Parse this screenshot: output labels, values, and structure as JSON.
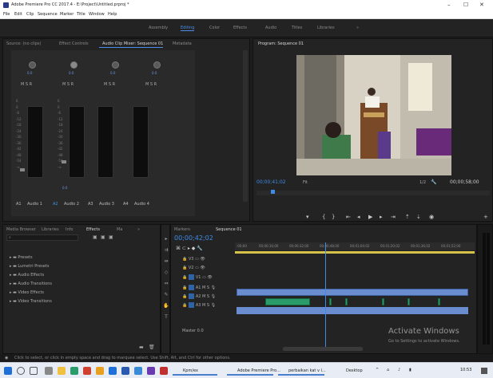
{
  "titlebar": {
    "title": "Adobe Premiere Pro CC 2017.4 - E:\\Project\\Untitled.prproj *",
    "minimize": "–",
    "maximize": "☐",
    "close": "✕"
  },
  "menubar": {
    "items": [
      "File",
      "Edit",
      "Clip",
      "Sequence",
      "Marker",
      "Title",
      "Window",
      "Help"
    ]
  },
  "workspaces": {
    "items": [
      "Assembly",
      "Editing",
      "Color",
      "Effects",
      "Audio",
      "Titles",
      "Libraries",
      "»"
    ],
    "active_index": 1
  },
  "mixer": {
    "tabs": [
      "Source: (no clips)",
      "Effect Controls",
      "Audio Clip Mixer: Sequence 01",
      "Metadata"
    ],
    "active_tab": 2,
    "track_labels": [
      "Audio 1",
      "Audio 2",
      "Audio 3",
      "Audio 4"
    ],
    "track_codes": [
      "A1",
      "A2",
      "A3",
      "A4"
    ],
    "value_label": "0.0",
    "mixer_tab_close": "≡"
  },
  "program": {
    "tab": "Program: Sequence 01",
    "timecode_left": "00;00;41;02",
    "timecode_right": "00;00;58;00",
    "zoom": "Fit",
    "quality": "1/2"
  },
  "project": {
    "tabs": [
      "Media Browser",
      "Libraries",
      "Info",
      "Effects",
      "Ma",
      "»"
    ],
    "active_tab": 3,
    "search_placeholder": "",
    "folders": [
      "Presets",
      "Lumetri Presets",
      "Audio Effects",
      "Audio Transitions",
      "Video Effects",
      "Video Transitions"
    ]
  },
  "timeline": {
    "tabs": [
      "Markers",
      "Sequence 01"
    ],
    "timecode": "00;00;42;02",
    "ruler": [
      ":00;00",
      "00;00;16;00",
      "00;00;32;00",
      "00;00;48;00",
      "00;01;04;02",
      "00;01;20;02",
      "00;01;36;02",
      "00;01;52;00"
    ],
    "tracks": [
      "V3",
      "V2",
      "V1",
      "A1",
      "A2",
      "A3",
      "Master"
    ],
    "master_value": "0.0"
  },
  "watermark": {
    "title": "Activate Windows",
    "subtitle": "Go to Settings to activate Windows."
  },
  "statusbar": {
    "text": "Click to select, or click in empty space and drag to marquee select. Use Shift, Alt, and Ctrl for other options."
  },
  "taskbar": {
    "tasks": [
      "Kpm/ex",
      "Adobe Premiere Pro...",
      "perbaikan kat v l...",
      "Desktop"
    ],
    "clock": "10:53",
    "tray_icons": [
      "chevron-up-icon",
      "network-icon",
      "volume-icon"
    ]
  },
  "colors": {
    "accent": "#3d8ce8",
    "video_clip": "#6a8dd0",
    "audio_clip": "#2a9b6a",
    "work_area": "#d4c24a"
  }
}
